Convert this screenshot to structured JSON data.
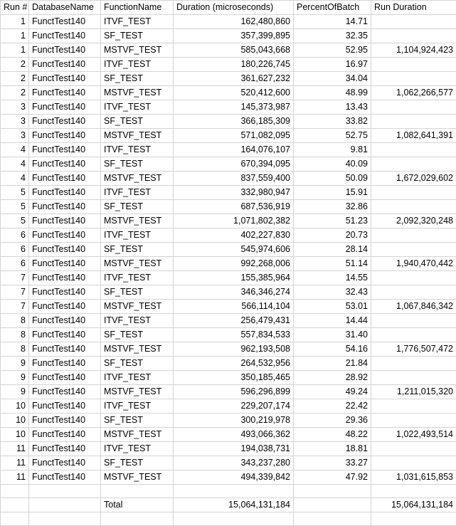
{
  "table": {
    "columns": [
      {
        "key": "run",
        "label": "Run #",
        "align": "num"
      },
      {
        "key": "db",
        "label": "DatabaseName",
        "align": "txt"
      },
      {
        "key": "fn",
        "label": "FunctionName",
        "align": "txt"
      },
      {
        "key": "dur",
        "label": "Duration (microseconds)",
        "align": "num"
      },
      {
        "key": "pct",
        "label": "PercentOfBatch",
        "align": "num"
      },
      {
        "key": "rd",
        "label": "Run Duration",
        "align": "num"
      }
    ],
    "rows": [
      {
        "run": "1",
        "db": "FunctTest140",
        "fn": "ITVF_TEST",
        "dur": "162,480,860",
        "pct": "14.71",
        "rd": ""
      },
      {
        "run": "1",
        "db": "FunctTest140",
        "fn": "SF_TEST",
        "dur": "357,399,895",
        "pct": "32.35",
        "rd": ""
      },
      {
        "run": "1",
        "db": "FunctTest140",
        "fn": "MSTVF_TEST",
        "dur": "585,043,668",
        "pct": "52.95",
        "rd": "1,104,924,423"
      },
      {
        "run": "2",
        "db": "FunctTest140",
        "fn": "ITVF_TEST",
        "dur": "180,226,745",
        "pct": "16.97",
        "rd": ""
      },
      {
        "run": "2",
        "db": "FunctTest140",
        "fn": "SF_TEST",
        "dur": "361,627,232",
        "pct": "34.04",
        "rd": ""
      },
      {
        "run": "2",
        "db": "FunctTest140",
        "fn": "MSTVF_TEST",
        "dur": "520,412,600",
        "pct": "48.99",
        "rd": "1,062,266,577"
      },
      {
        "run": "3",
        "db": "FunctTest140",
        "fn": "ITVF_TEST",
        "dur": "145,373,987",
        "pct": "13.43",
        "rd": ""
      },
      {
        "run": "3",
        "db": "FunctTest140",
        "fn": "SF_TEST",
        "dur": "366,185,309",
        "pct": "33.82",
        "rd": ""
      },
      {
        "run": "3",
        "db": "FunctTest140",
        "fn": "MSTVF_TEST",
        "dur": "571,082,095",
        "pct": "52.75",
        "rd": "1,082,641,391"
      },
      {
        "run": "4",
        "db": "FunctTest140",
        "fn": "ITVF_TEST",
        "dur": "164,076,107",
        "pct": "9.81",
        "rd": ""
      },
      {
        "run": "4",
        "db": "FunctTest140",
        "fn": "SF_TEST",
        "dur": "670,394,095",
        "pct": "40.09",
        "rd": ""
      },
      {
        "run": "4",
        "db": "FunctTest140",
        "fn": "MSTVF_TEST",
        "dur": "837,559,400",
        "pct": "50.09",
        "rd": "1,672,029,602"
      },
      {
        "run": "5",
        "db": "FunctTest140",
        "fn": "ITVF_TEST",
        "dur": "332,980,947",
        "pct": "15.91",
        "rd": ""
      },
      {
        "run": "5",
        "db": "FunctTest140",
        "fn": "SF_TEST",
        "dur": "687,536,919",
        "pct": "32.86",
        "rd": ""
      },
      {
        "run": "5",
        "db": "FunctTest140",
        "fn": "MSTVF_TEST",
        "dur": "1,071,802,382",
        "pct": "51.23",
        "rd": "2,092,320,248"
      },
      {
        "run": "6",
        "db": "FunctTest140",
        "fn": "ITVF_TEST",
        "dur": "402,227,830",
        "pct": "20.73",
        "rd": ""
      },
      {
        "run": "6",
        "db": "FunctTest140",
        "fn": "SF_TEST",
        "dur": "545,974,606",
        "pct": "28.14",
        "rd": ""
      },
      {
        "run": "6",
        "db": "FunctTest140",
        "fn": "MSTVF_TEST",
        "dur": "992,268,006",
        "pct": "51.14",
        "rd": "1,940,470,442"
      },
      {
        "run": "7",
        "db": "FunctTest140",
        "fn": "ITVF_TEST",
        "dur": "155,385,964",
        "pct": "14.55",
        "rd": ""
      },
      {
        "run": "7",
        "db": "FunctTest140",
        "fn": "SF_TEST",
        "dur": "346,346,274",
        "pct": "32.43",
        "rd": ""
      },
      {
        "run": "7",
        "db": "FunctTest140",
        "fn": "MSTVF_TEST",
        "dur": "566,114,104",
        "pct": "53.01",
        "rd": "1,067,846,342"
      },
      {
        "run": "8",
        "db": "FunctTest140",
        "fn": "ITVF_TEST",
        "dur": "256,479,431",
        "pct": "14.44",
        "rd": ""
      },
      {
        "run": "8",
        "db": "FunctTest140",
        "fn": "SF_TEST",
        "dur": "557,834,533",
        "pct": "31.40",
        "rd": ""
      },
      {
        "run": "8",
        "db": "FunctTest140",
        "fn": "MSTVF_TEST",
        "dur": "962,193,508",
        "pct": "54.16",
        "rd": "1,776,507,472"
      },
      {
        "run": "9",
        "db": "FunctTest140",
        "fn": "SF_TEST",
        "dur": "264,532,956",
        "pct": "21.84",
        "rd": ""
      },
      {
        "run": "9",
        "db": "FunctTest140",
        "fn": "ITVF_TEST",
        "dur": "350,185,465",
        "pct": "28.92",
        "rd": ""
      },
      {
        "run": "9",
        "db": "FunctTest140",
        "fn": "MSTVF_TEST",
        "dur": "596,296,899",
        "pct": "49.24",
        "rd": "1,211,015,320"
      },
      {
        "run": "10",
        "db": "FunctTest140",
        "fn": "ITVF_TEST",
        "dur": "229,207,174",
        "pct": "22.42",
        "rd": ""
      },
      {
        "run": "10",
        "db": "FunctTest140",
        "fn": "SF_TEST",
        "dur": "300,219,978",
        "pct": "29.36",
        "rd": ""
      },
      {
        "run": "10",
        "db": "FunctTest140",
        "fn": "MSTVF_TEST",
        "dur": "493,066,362",
        "pct": "48.22",
        "rd": "1,022,493,514"
      },
      {
        "run": "11",
        "db": "FunctTest140",
        "fn": "ITVF_TEST",
        "dur": "194,038,731",
        "pct": "18.81",
        "rd": ""
      },
      {
        "run": "11",
        "db": "FunctTest140",
        "fn": "SF_TEST",
        "dur": "343,237,280",
        "pct": "33.27",
        "rd": ""
      },
      {
        "run": "11",
        "db": "FunctTest140",
        "fn": "MSTVF_TEST",
        "dur": "494,339,842",
        "pct": "47.92",
        "rd": "1,031,615,853"
      },
      {
        "run": "",
        "db": "",
        "fn": "",
        "dur": "",
        "pct": "",
        "rd": ""
      },
      {
        "run": "",
        "db": "",
        "fn": "Total",
        "dur": "15,064,131,184",
        "pct": "",
        "rd": "15,064,131,184"
      },
      {
        "run": "",
        "db": "",
        "fn": "",
        "dur": "",
        "pct": "",
        "rd": ""
      }
    ]
  }
}
